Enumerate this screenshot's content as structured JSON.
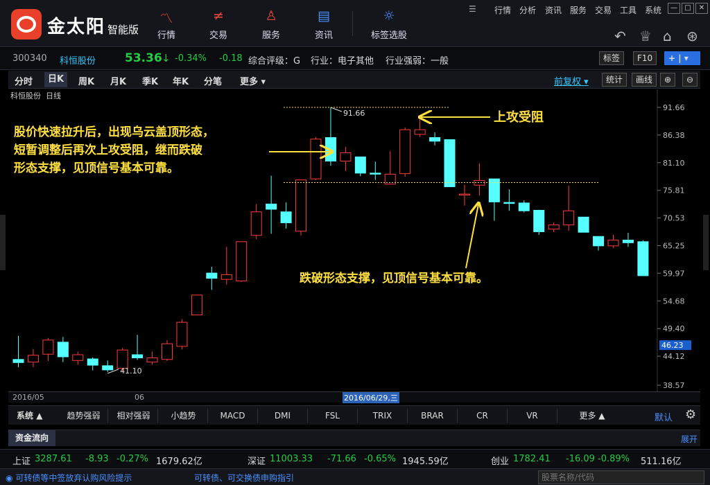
{
  "app": {
    "brand": "金太阳",
    "brand_sub": "智能版"
  },
  "nav": [
    {
      "label": "行情",
      "icon": "chart-line-icon"
    },
    {
      "label": "交易",
      "icon": "trade-icon"
    },
    {
      "label": "服务",
      "icon": "user-icon"
    },
    {
      "label": "资讯",
      "icon": "news-icon"
    },
    {
      "label": "标签选股",
      "icon": "bulb-icon"
    }
  ],
  "menu": [
    "行情",
    "分析",
    "资讯",
    "服务",
    "交易",
    "工具",
    "系统"
  ],
  "quote": {
    "code": "300340",
    "name": "科恒股份",
    "price": "53.36",
    "arrow": "↓",
    "change_pct": "-0.34%",
    "change": "-0.18",
    "rating": "综合评级：G",
    "industry": "行业：电子其他",
    "industry_strength": "行业强弱：一般",
    "btn_tag": "标签",
    "btn_f10": "F10",
    "btn_plus": "+"
  },
  "tabs": [
    "分时",
    "日K",
    "周K",
    "月K",
    "季K",
    "年K",
    "分笔",
    "更多"
  ],
  "tab_right": {
    "adjust": "前复权",
    "stats": "统计",
    "draw": "画线"
  },
  "chart_header": {
    "name": "科恒股份",
    "period": "日线"
  },
  "chart_data": {
    "type": "candlestick",
    "y_ticks": [
      "91.66",
      "86.38",
      "81.10",
      "75.81",
      "70.53",
      "65.25",
      "59.97",
      "54.68",
      "49.40",
      "44.12",
      "38.57"
    ],
    "y_min": 38.57,
    "y_max": 91.66,
    "current_price_label": "46.23",
    "high_label": "91.66",
    "low_label": "41.10",
    "date_labels": [
      "2016/05",
      "06"
    ],
    "cursor_date": "2016/06/29,三",
    "candles": [
      {
        "o": 43.5,
        "h": 48.0,
        "l": 42.0,
        "c": 42.9,
        "dir": "down"
      },
      {
        "o": 43.0,
        "h": 45.5,
        "l": 42.0,
        "c": 44.3,
        "dir": "up"
      },
      {
        "o": 44.5,
        "h": 47.6,
        "l": 43.2,
        "c": 47.2,
        "dir": "up"
      },
      {
        "o": 46.8,
        "h": 47.8,
        "l": 43.0,
        "c": 44.0,
        "dir": "down"
      },
      {
        "o": 43.3,
        "h": 45.0,
        "l": 42.5,
        "c": 44.4,
        "dir": "up"
      },
      {
        "o": 43.6,
        "h": 43.9,
        "l": 41.4,
        "c": 42.4,
        "dir": "down"
      },
      {
        "o": 42.3,
        "h": 43.3,
        "l": 41.1,
        "c": 41.5,
        "dir": "down"
      },
      {
        "o": 41.8,
        "h": 45.7,
        "l": 41.2,
        "c": 45.3,
        "dir": "up"
      },
      {
        "o": 44.4,
        "h": 48.2,
        "l": 43.4,
        "c": 43.8,
        "dir": "down"
      },
      {
        "o": 43.0,
        "h": 45.0,
        "l": 42.5,
        "c": 43.8,
        "dir": "up"
      },
      {
        "o": 43.5,
        "h": 47.2,
        "l": 43.2,
        "c": 46.5,
        "dir": "up"
      },
      {
        "o": 46.0,
        "h": 51.2,
        "l": 45.4,
        "c": 50.6,
        "dir": "up"
      },
      {
        "o": 52.0,
        "h": 55.8,
        "l": 52.0,
        "c": 55.8,
        "dir": "up"
      },
      {
        "o": 60.0,
        "h": 61.2,
        "l": 56.8,
        "c": 59.0,
        "dir": "down"
      },
      {
        "o": 58.8,
        "h": 65.0,
        "l": 57.8,
        "c": 59.7,
        "dir": "up"
      },
      {
        "o": 58.5,
        "h": 66.0,
        "l": 58.3,
        "c": 66.0,
        "dir": "up"
      },
      {
        "o": 67.2,
        "h": 73.2,
        "l": 66.5,
        "c": 71.7,
        "dir": "up"
      },
      {
        "o": 73.2,
        "h": 78.6,
        "l": 67.5,
        "c": 72.2,
        "dir": "down"
      },
      {
        "o": 71.7,
        "h": 73.5,
        "l": 68.5,
        "c": 69.6,
        "dir": "down"
      },
      {
        "o": 68.0,
        "h": 77.8,
        "l": 67.2,
        "c": 77.8,
        "dir": "up"
      },
      {
        "o": 78.0,
        "h": 86.0,
        "l": 77.8,
        "c": 85.6,
        "dir": "up"
      },
      {
        "o": 85.9,
        "h": 91.66,
        "l": 80.5,
        "c": 81.4,
        "dir": "down"
      },
      {
        "o": 81.4,
        "h": 84.1,
        "l": 79.5,
        "c": 83.0,
        "dir": "up"
      },
      {
        "o": 82.2,
        "h": 82.2,
        "l": 78.5,
        "c": 79.1,
        "dir": "down"
      },
      {
        "o": 79.1,
        "h": 81.3,
        "l": 77.8,
        "c": 78.9,
        "dir": "down"
      },
      {
        "o": 77.0,
        "h": 83.3,
        "l": 76.9,
        "c": 78.9,
        "dir": "up"
      },
      {
        "o": 79.0,
        "h": 87.8,
        "l": 78.4,
        "c": 87.4,
        "dir": "up"
      },
      {
        "o": 86.5,
        "h": 89.4,
        "l": 86.0,
        "c": 87.4,
        "dir": "up"
      },
      {
        "o": 85.9,
        "h": 86.9,
        "l": 84.4,
        "c": 85.2,
        "dir": "down"
      },
      {
        "o": 85.5,
        "h": 85.5,
        "l": 76.5,
        "c": 76.5,
        "dir": "down"
      },
      {
        "o": 75.1,
        "h": 76.9,
        "l": 72.9,
        "c": 75.1,
        "dir": "up"
      },
      {
        "o": 76.8,
        "h": 81.0,
        "l": 74.8,
        "c": 77.7,
        "dir": "up"
      },
      {
        "o": 78.0,
        "h": 78.0,
        "l": 70.0,
        "c": 73.6,
        "dir": "down"
      },
      {
        "o": 73.5,
        "h": 76.0,
        "l": 71.9,
        "c": 73.5,
        "dir": "down"
      },
      {
        "o": 73.4,
        "h": 73.9,
        "l": 71.6,
        "c": 71.9,
        "dir": "down"
      },
      {
        "o": 72.0,
        "h": 72.1,
        "l": 67.3,
        "c": 67.9,
        "dir": "down"
      },
      {
        "o": 68.4,
        "h": 69.7,
        "l": 67.8,
        "c": 69.2,
        "dir": "up"
      },
      {
        "o": 69.2,
        "h": 76.7,
        "l": 68.1,
        "c": 71.9,
        "dir": "up"
      },
      {
        "o": 70.7,
        "h": 70.7,
        "l": 67.8,
        "c": 67.8,
        "dir": "down"
      },
      {
        "o": 67.0,
        "h": 67.0,
        "l": 64.3,
        "c": 65.2,
        "dir": "down"
      },
      {
        "o": 65.2,
        "h": 67.3,
        "l": 64.8,
        "c": 66.3,
        "dir": "up"
      },
      {
        "o": 66.3,
        "h": 67.7,
        "l": 65.0,
        "c": 65.8,
        "dir": "down"
      },
      {
        "o": 66.0,
        "h": 66.3,
        "l": 59.5,
        "c": 59.5,
        "dir": "down"
      }
    ]
  },
  "annotations": {
    "left_text_1": "股价快速拉升后，出现乌云盖顶形态，",
    "left_text_2": "短暂调整后再次上攻受阻，继而跌破",
    "left_text_3": "形态支撑，见顶信号基本可靠。",
    "top_label": "上攻受阻",
    "bottom_label": "跌破形态支撑，见顶信号基本可靠。"
  },
  "indicators": {
    "system": "系统",
    "items": [
      "趋势强弱",
      "相对强弱",
      "小趋势",
      "MACD",
      "DMI",
      "FSL",
      "TRIX",
      "BRAR",
      "CR",
      "VR",
      "更多"
    ],
    "default": "默认"
  },
  "flow": {
    "title": "资金流向",
    "expand": "展开"
  },
  "status": {
    "sh_name": "上证",
    "sh_val": "3287.61",
    "sh_chg": "-8.93",
    "sh_pct": "-0.27%",
    "sh_amt": "1679.62亿",
    "sz_name": "深证",
    "sz_val": "11003.33",
    "sz_chg": "-71.66",
    "sz_pct": "-0.65%",
    "sz_amt": "1945.59亿",
    "cy_name": "创业",
    "cy_val": "1782.41",
    "cy_chg": "-16.09",
    "cy_pct": "-0.89%",
    "cy_amt": "511.16亿"
  },
  "bottom": {
    "notice1": "可转债等中签放弃认购风险提示",
    "notice2": "可转债、可交换债申购指引",
    "search_placeholder": "股票名称/代码"
  }
}
